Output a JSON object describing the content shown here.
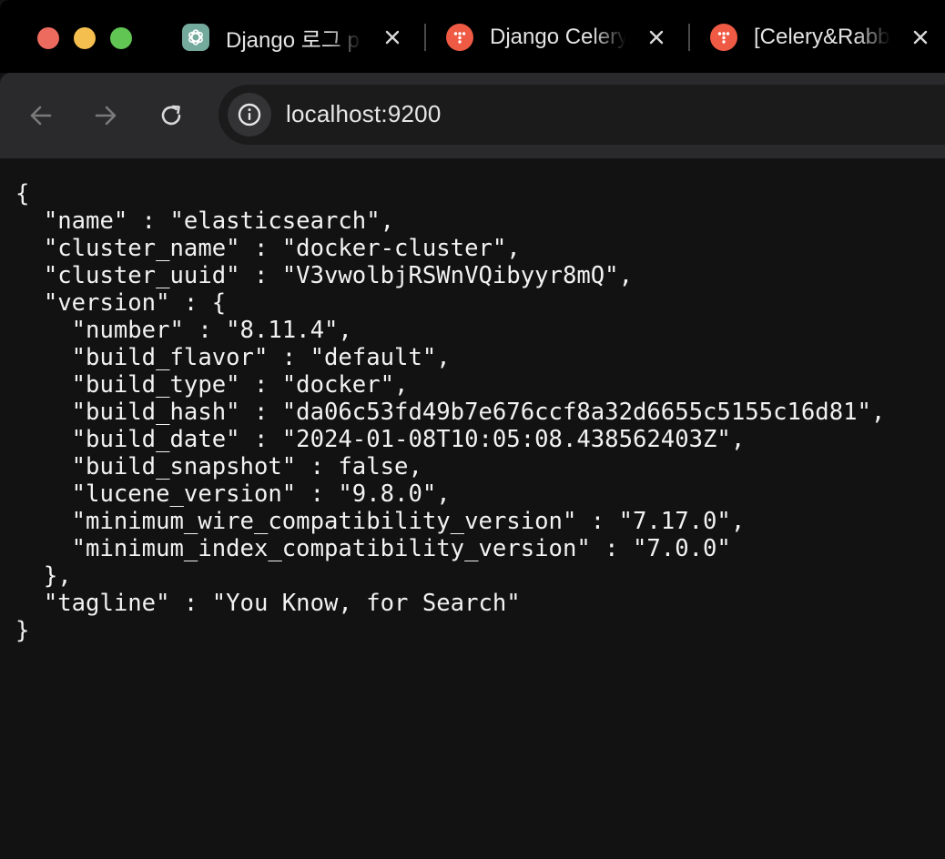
{
  "tabs": [
    {
      "title": "Django 로그 p",
      "icon": "chatgpt-icon"
    },
    {
      "title": "Django Celery",
      "icon": "pinned-red-icon"
    },
    {
      "title": "[Celery&Rabbit",
      "icon": "pinned-red-icon"
    }
  ],
  "address_bar": {
    "url": "localhost:9200",
    "site_info_icon": "info-icon"
  },
  "toolbar_icons": [
    "back-arrow-icon",
    "forward-arrow-icon",
    "reload-icon"
  ],
  "json_lines": [
    "{",
    "  \"name\" : \"elasticsearch\",",
    "  \"cluster_name\" : \"docker-cluster\",",
    "  \"cluster_uuid\" : \"V3vwolbjRSWnVQibyyr8mQ\",",
    "  \"version\" : {",
    "    \"number\" : \"8.11.4\",",
    "    \"build_flavor\" : \"default\",",
    "    \"build_type\" : \"docker\",",
    "    \"build_hash\" : \"da06c53fd49b7e676ccf8a32d6655c5155c16d81\",",
    "    \"build_date\" : \"2024-01-08T10:05:08.438562403Z\",",
    "    \"build_snapshot\" : false,",
    "    \"lucene_version\" : \"9.8.0\",",
    "    \"minimum_wire_compatibility_version\" : \"7.17.0\",",
    "    \"minimum_index_compatibility_version\" : \"7.0.0\"",
    "  },",
    "  \"tagline\" : \"You Know, for Search\"",
    "}"
  ],
  "colors": {
    "tabstrip_bg": "#000000",
    "toolbar_bg": "#2a2a2c",
    "omnibox_bg": "#1b1b1c",
    "page_bg": "#121212",
    "text": "#f2f2f2",
    "traffic_close": "#ed6a5e",
    "traffic_minimize": "#f5bf4f",
    "traffic_maximize": "#61c554",
    "favicon_red": "#ef5a45",
    "favicon_chatgpt": "#74aa9c"
  }
}
